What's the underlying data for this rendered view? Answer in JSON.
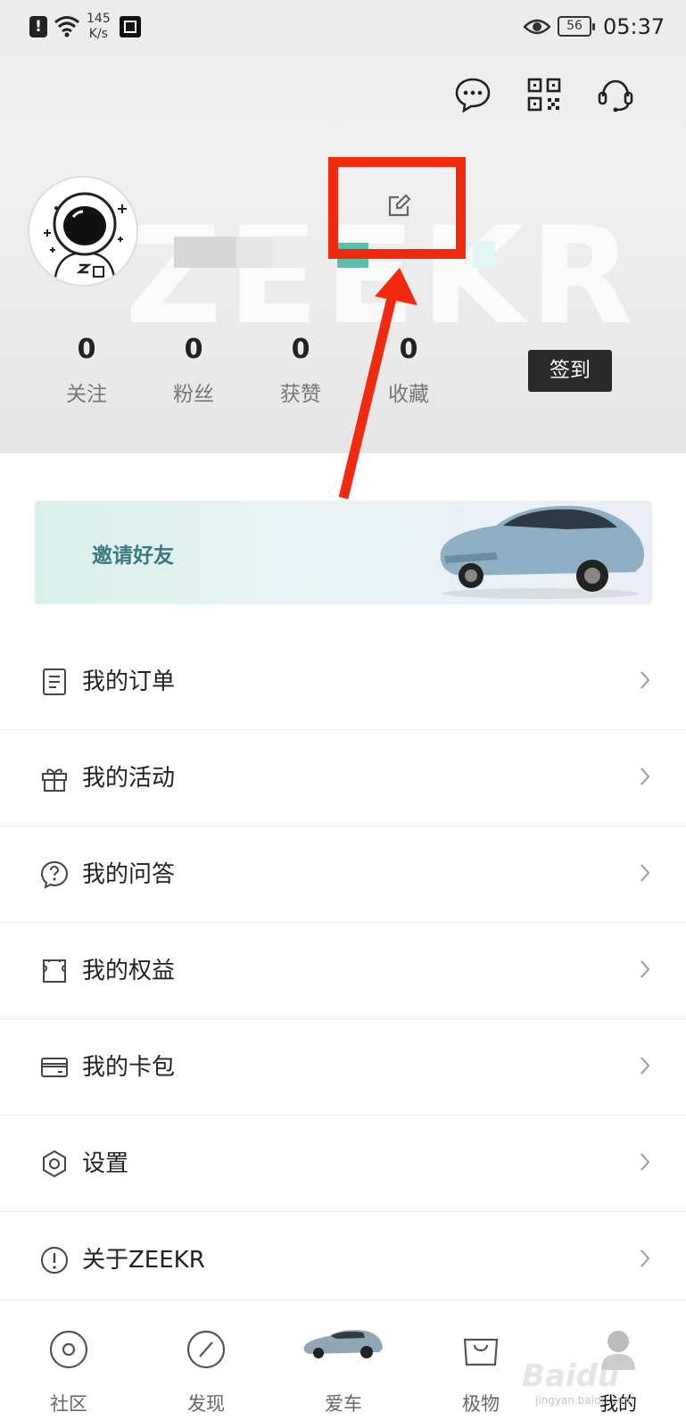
{
  "status_bar": {
    "net_speed_value": "145",
    "net_speed_unit": "K/s",
    "battery": "56",
    "time": "05:37"
  },
  "header_icons": [
    "message-icon",
    "qr-code-icon",
    "customer-service-icon"
  ],
  "profile": {
    "stats": [
      {
        "value": "0",
        "label": "关注"
      },
      {
        "value": "0",
        "label": "粉丝"
      },
      {
        "value": "0",
        "label": "获赞"
      },
      {
        "value": "0",
        "label": "收藏"
      }
    ],
    "signin_label": "签到"
  },
  "banner": {
    "label": "邀请好友"
  },
  "menu": [
    {
      "label": "我的订单",
      "icon": "order-icon"
    },
    {
      "label": "我的活动",
      "icon": "gift-icon"
    },
    {
      "label": "我的问答",
      "icon": "question-icon"
    },
    {
      "label": "我的权益",
      "icon": "ticket-icon"
    },
    {
      "label": "我的卡包",
      "icon": "card-icon"
    },
    {
      "label": "设置",
      "icon": "settings-icon"
    },
    {
      "label": "关于ZEEKR",
      "icon": "info-icon"
    }
  ],
  "tabbar": [
    {
      "label": "社区",
      "icon": "community-icon"
    },
    {
      "label": "发现",
      "icon": "discover-icon"
    },
    {
      "label": "爱车",
      "icon": "car-icon"
    },
    {
      "label": "极物",
      "icon": "shopping-bag-icon"
    },
    {
      "label": "我的",
      "icon": "profile-icon",
      "active": true
    }
  ],
  "watermark": {
    "brand": "Baidu",
    "url": "jingyan.baidu.com"
  },
  "colors": {
    "highlight_red": "#f22a10",
    "signin_bg": "#2a2a2a",
    "banner_text": "#3d7a80"
  }
}
